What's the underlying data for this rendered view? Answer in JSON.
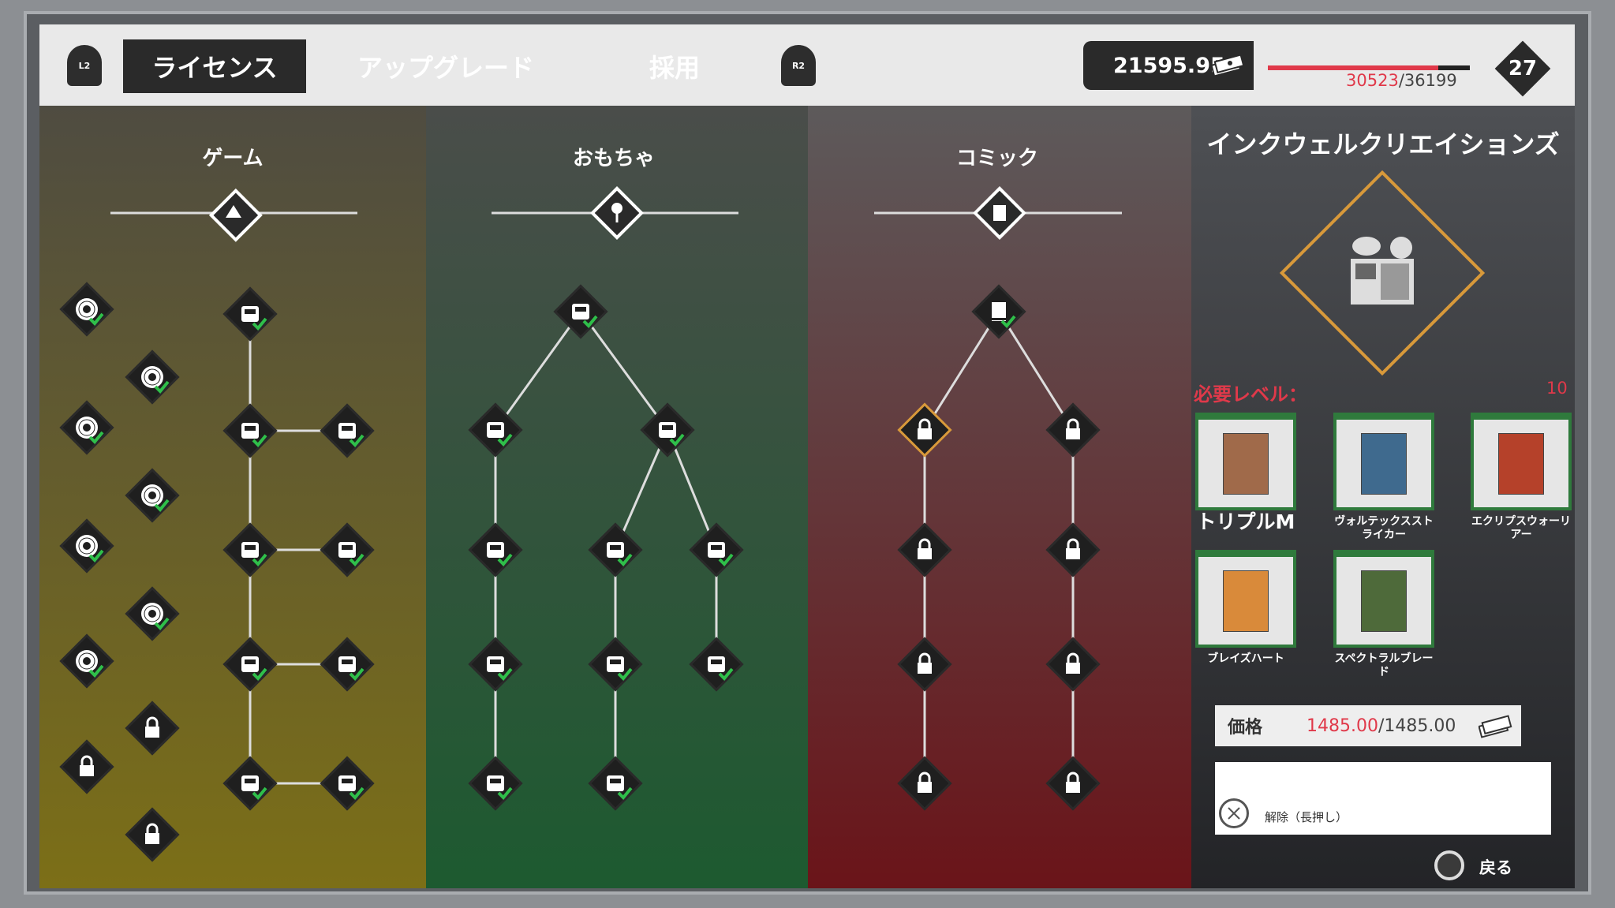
{
  "topbar": {
    "l2": "L2",
    "r2": "R2",
    "tabs": [
      "ライセンス",
      "アップグレード",
      "採用"
    ],
    "active_tab": "ライセンス",
    "money": "21595.95",
    "xp_current": "30523",
    "xp_total": "/36199",
    "xp_fraction": 0.843,
    "level": "27"
  },
  "columns": [
    {
      "title": "ゲーム",
      "color_top": "#4f4c41",
      "color_bottom": "#7c6f17"
    },
    {
      "title": "おもちゃ",
      "color_top": "#4a4d4a",
      "color_bottom": "#1d5a30"
    },
    {
      "title": "コミック",
      "color_top": "#5d5a5b",
      "color_bottom": "#6a1419"
    }
  ],
  "panel": {
    "title": "インクウェルクリエイションズ",
    "required_level_label": "必要レベル：",
    "required_level": "10",
    "items": [
      {
        "label": "トリプルM",
        "cover": "#a06a4a"
      },
      {
        "label": "ヴォルテックスストライカー",
        "cover": "#3f6a8e"
      },
      {
        "label": "エクリプスウォーリアー",
        "cover": "#b5412a"
      },
      {
        "label": "ブレイズハート",
        "cover": "#d98a3a"
      },
      {
        "label": "スペクトラルブレード",
        "cover": "#4e6a3a"
      }
    ],
    "price_label": "価格",
    "price_current": "1485.00",
    "price_total": "/1485.00",
    "release_label": "解除（長押し）",
    "back_label": "戻る"
  },
  "colors": {
    "accent_red": "#e0394a",
    "highlight_orange": "#d8993a",
    "check_green": "#2fbf4a"
  }
}
